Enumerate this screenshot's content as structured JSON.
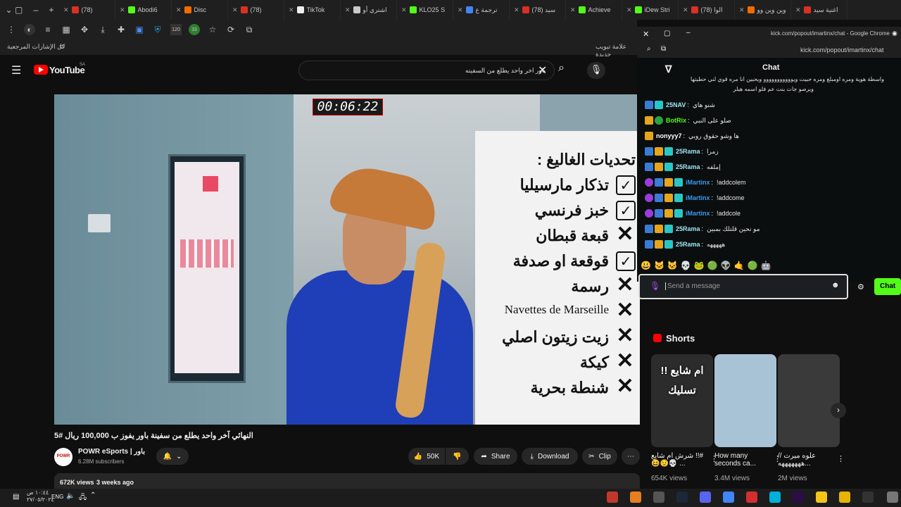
{
  "tabs": [
    {
      "label": "(78)",
      "fav": "#d93025",
      "icon": "youtube-icon"
    },
    {
      "label": "Abodi6",
      "fav": "#53fc18",
      "icon": "kick-icon"
    },
    {
      "label": "Disc",
      "fav": "#ef6c00",
      "icon": "discord-icon"
    },
    {
      "label": "(78)",
      "fav": "#d93025",
      "icon": "youtube-icon"
    },
    {
      "label": "TikTok",
      "fav": "#eeeeee",
      "icon": "tiktok-icon"
    },
    {
      "label": "اشتري أو",
      "fav": "#c9c9c9",
      "icon": "store-icon"
    },
    {
      "label": "KLO25 S",
      "fav": "#53fc18",
      "icon": "kick-icon"
    },
    {
      "label": "ترجمة ع",
      "fav": "#4285f4",
      "icon": "translate-icon"
    },
    {
      "label": "(78) سيد",
      "fav": "#d93025",
      "icon": "youtube-icon"
    },
    {
      "label": "Achieve",
      "fav": "#53fc18",
      "icon": "kick-icon"
    },
    {
      "label": "iDew Stri",
      "fav": "#53fc18",
      "icon": "kick-icon"
    },
    {
      "label": "(78) الوا",
      "fav": "#d93025",
      "icon": "youtube-icon"
    },
    {
      "label": "وين وين وو",
      "fav": "#ef6c00",
      "icon": "store-icon"
    },
    {
      "label": "اغنية سيد",
      "fav": "#d93025",
      "icon": "youtube-icon"
    }
  ],
  "bookmarks": {
    "all_label": "كل الإشارات المرجعية",
    "new_tab_label": "علامة تبويب جديدة"
  },
  "youtube": {
    "logo_text": "YouTube",
    "region": "SA",
    "search_query": "باور اخر واحد يطلع من السفينه",
    "video": {
      "timer": "00:06:22",
      "title": "النهائي آخر واحد يطلع من سفينة باور يفوز ب 100,000 ريال #5",
      "challenge_heading": "تحديات الغاليغ :",
      "challenges": [
        {
          "text": "تذكار مارسيليا",
          "status": "check"
        },
        {
          "text": "خبز فرنسي",
          "status": "check"
        },
        {
          "text": "قبعة قبطان",
          "status": "cross"
        },
        {
          "text": "قوقعة او صدفة",
          "status": "check"
        },
        {
          "text": "رسمة",
          "status": "cross"
        },
        {
          "text": "Navettes de Marseille",
          "status": "cross"
        },
        {
          "text": "زيت زيتون اصلي",
          "status": "cross"
        },
        {
          "text": "كيكة",
          "status": "cross"
        },
        {
          "text": "شنطة بحرية",
          "status": "cross"
        }
      ]
    },
    "channel": {
      "name": "POWR eSports | باور",
      "subscribers": "6.28M subscribers"
    },
    "actions": {
      "likes": "50K",
      "share": "Share",
      "download": "Download",
      "clip": "Clip",
      "more": "⋯"
    },
    "meta": {
      "views": "672K views",
      "age": "3 weeks ago"
    },
    "shorts": {
      "heading": "Shorts",
      "items": [
        {
          "title": "شرش ام شايع !!# 😆😟💀 ...",
          "views": "654K views",
          "overlay": "ام شايع !! تسليك",
          "bg": "#2c2c2c"
        },
        {
          "title": "How many seconds ca...",
          "views": "3.4M views",
          "overlay": "",
          "bg": "#a9c3d6"
        },
        {
          "title": "علوه ميرت //هههههههه...",
          "views": "2M views",
          "overlay": "",
          "bg": "#3a3a3a"
        }
      ]
    }
  },
  "chat": {
    "window_url": "kick.com/popout/imartinx/chat - Google Chrome",
    "address": "kick.com/popout/imartinx/chat",
    "title": "Chat",
    "input_placeholder": "Send a message",
    "send_label": "Chat",
    "first_line": "واسطة هوية ومره اومبلغ ومره حبيت ويووووووووووو ويحبين انا مره قوي لني حطيتها",
    "first_line_2": "ويرصو جات بنت عم فلو اسمه هيلر",
    "messages": [
      {
        "user": "25NAV",
        "text": "شنو هاي",
        "color": "#9fe6f5",
        "badges": [
          "b-blue",
          "b-teal"
        ]
      },
      {
        "user": "BotRix",
        "text": "صلو على النبي",
        "color": "#53fc18",
        "badges": [
          "b-gold",
          "b-green"
        ]
      },
      {
        "user": "nonyyy7",
        "text": "ها وشو حقوق روبي",
        "color": "#ffffff",
        "badges": [
          "b-gold"
        ]
      },
      {
        "user": "25Rama",
        "text": "زمرا",
        "color": "#9fe6f5",
        "badges": [
          "b-blue",
          "b-gold",
          "b-teal"
        ]
      },
      {
        "user": "25Rama",
        "text": "إملفه",
        "color": "#9fe6f5",
        "badges": [
          "b-blue",
          "b-gold",
          "b-teal"
        ]
      },
      {
        "user": "iMartinx",
        "text": "!addcolem",
        "color": "#3a9af0",
        "badges": [
          "b-mic",
          "b-blue",
          "b-gold",
          "b-teal"
        ]
      },
      {
        "user": "iMartinx",
        "text": "!addcome",
        "color": "#3a9af0",
        "badges": [
          "b-mic",
          "b-blue",
          "b-gold",
          "b-teal"
        ]
      },
      {
        "user": "iMartinx",
        "text": "!addcole",
        "color": "#3a9af0",
        "badges": [
          "b-mic",
          "b-blue",
          "b-gold",
          "b-teal"
        ]
      },
      {
        "user": "25Rama",
        "text": "مو نحين قلتلك بمبين",
        "color": "#9fe6f5",
        "badges": [
          "b-blue",
          "b-gold",
          "b-teal"
        ]
      },
      {
        "user": "25Rama",
        "text": "هههههه",
        "color": "#9fe6f5",
        "badges": [
          "b-blue",
          "b-gold",
          "b-teal"
        ]
      }
    ],
    "emotes": [
      "😃",
      "🐱",
      "🐱",
      "💀",
      "🐸",
      "🟢",
      "👽",
      "🤙",
      "🟢",
      "🤖"
    ]
  },
  "taskbar": {
    "lang": "ENG",
    "time": "١٠:٤٤ ص",
    "date": "٢٧/٠٥/٢٠٢٤"
  }
}
